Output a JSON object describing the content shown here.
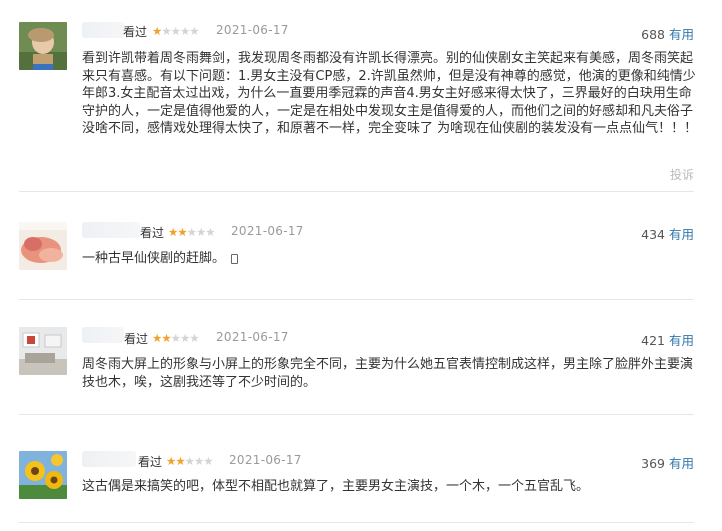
{
  "reviews": [
    {
      "status": "看过",
      "rating": 1,
      "date": "2021-06-17",
      "votes": "688",
      "vote_label": "有用",
      "report_label": "投诉",
      "content": "看到许凯带着周冬雨舞剑，我发现周冬雨都没有许凯长得漂亮。别的仙侠剧女主笑起来有美感，周冬雨笑起来只有喜感。有以下问题：1.男女主没有CP感，2.许凯虽然帅，但是没有神尊的感觉，他演的更像和纯情少年郎3.女主配音太过出戏，为什么一直要用季冠霖的声音4.男女主好感来得太快了，三界最好的白玦用生命守护的人，一定是值得他爱的人，一定是在相处中发现女主是值得爱的人，而他们之间的好感却和凡夫俗子没啥不同，感情戏处理得太快了，和原著不一样，完全变味了 为啥现在仙侠剧的装发没有一点点仙气！！！"
    },
    {
      "status": "看过",
      "rating": 2,
      "date": "2021-06-17",
      "votes": "434",
      "vote_label": "有用",
      "content": "一种古早仙侠剧的赶脚。"
    },
    {
      "status": "看过",
      "rating": 2,
      "date": "2021-06-17",
      "votes": "421",
      "vote_label": "有用",
      "content": "周冬雨大屏上的形象与小屏上的形象完全不同，主要为什么她五官表情控制成这样，男主除了脸胖外主要演技也木，唉，这剧我还等了不少时间的。"
    },
    {
      "status": "看过",
      "rating": 2,
      "date": "2021-06-17",
      "votes": "369",
      "vote_label": "有用",
      "content": "这古偶是来搞笑的吧，体型不相配也就算了，主要男女主演技，一个木，一个五官乱飞。"
    }
  ],
  "colors": {
    "star_on": "#f2a22a",
    "star_off": "#d4d4d4",
    "link": "#3377aa",
    "date": "#9a9a9a"
  }
}
